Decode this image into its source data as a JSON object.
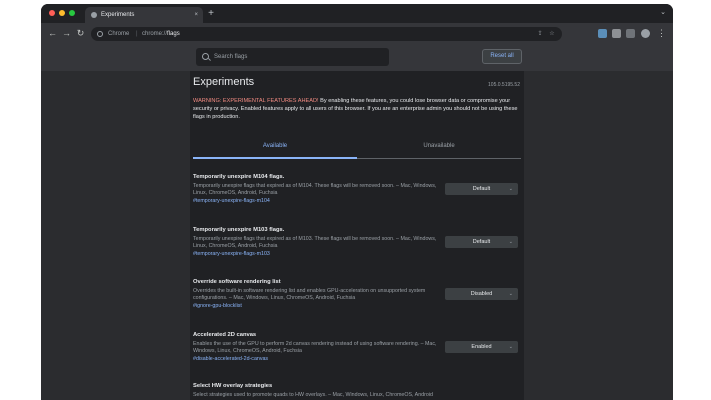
{
  "browser": {
    "tab_title": "Experiments",
    "tab_close": "×",
    "new_tab": "+",
    "tab_search": "⌄",
    "omnibox_chrome": "Chrome",
    "omnibox_sep": "|",
    "omnibox_url_prefix": "chrome://",
    "omnibox_url_page": "flags",
    "colors": {
      "red": "#ff5f57",
      "yellow": "#febc2e",
      "green": "#28c840"
    }
  },
  "nav": {
    "back": "←",
    "forward": "→",
    "reload": "↻"
  },
  "search": {
    "placeholder": "Search flags"
  },
  "reset_button": "Reset all",
  "page": {
    "title": "Experiments",
    "version": "105.0.5195.52",
    "warning_prefix": "WARNING: EXPERIMENTAL FEATURES AHEAD!",
    "warning_text": " By enabling these features, you could lose browser data or compromise your security or privacy. Enabled features apply to all users of this browser. If you are an enterprise admin you should not be using these flags in production.",
    "tabs": [
      "Available",
      "Unavailable"
    ]
  },
  "experiments": [
    {
      "title": "Temporarily unexpire M104 flags.",
      "desc": "Temporarily unexpire flags that expired as of M104. These flags will be removed soon. – Mac, Windows, Linux, ChromeOS, Android, Fuchsia",
      "link": "#temporary-unexpire-flags-m104",
      "value": "Default"
    },
    {
      "title": "Temporarily unexpire M103 flags.",
      "desc": "Temporarily unexpire flags that expired as of M103. These flags will be removed soon. – Mac, Windows, Linux, ChromeOS, Android, Fuchsia",
      "link": "#temporary-unexpire-flags-m103",
      "value": "Default"
    },
    {
      "title": "Override software rendering list",
      "desc": "Overrides the built-in software rendering list and enables GPU-acceleration on unsupported system configurations. – Mac, Windows, Linux, ChromeOS, Android, Fuchsia",
      "link": "#ignore-gpu-blocklist",
      "value": "Disabled"
    },
    {
      "title": "Accelerated 2D canvas",
      "desc": "Enables the use of the GPU to perform 2d canvas rendering instead of using software rendering. – Mac, Windows, Linux, ChromeOS, Android, Fuchsia",
      "link": "#disable-accelerated-2d-canvas",
      "value": "Enabled"
    },
    {
      "title": "Select HW overlay strategies",
      "desc": "Select strategies used to promote quads to HW overlays. – Mac, Windows, Linux, ChromeOS, Android",
      "link": "",
      "value": ""
    }
  ]
}
